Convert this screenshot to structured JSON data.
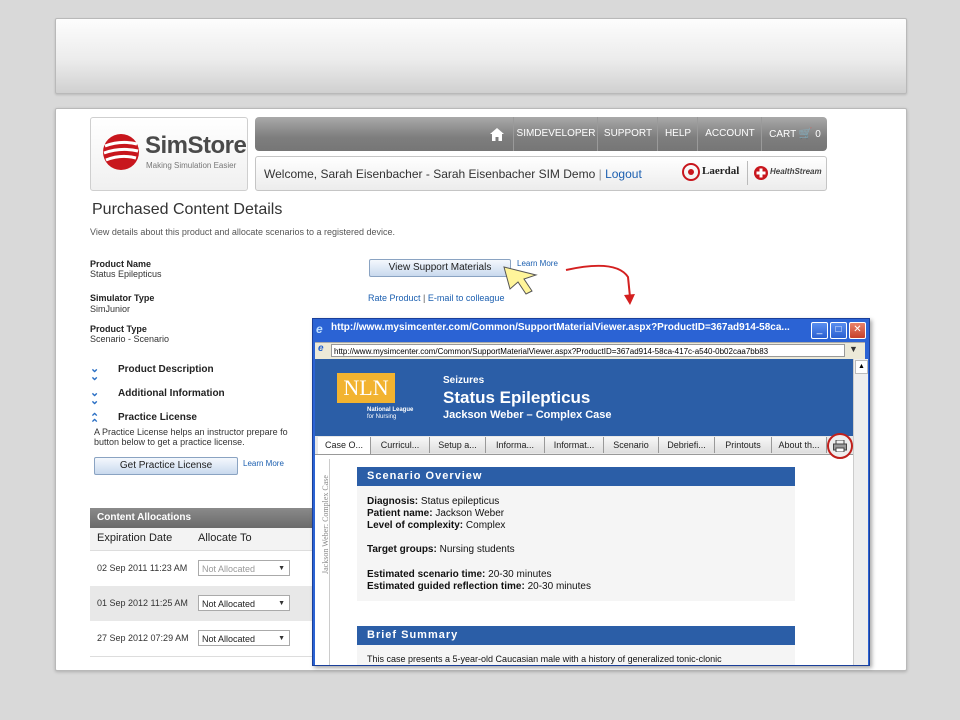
{
  "header": {
    "logo_name": "SimStore",
    "logo_tagline": "Making Simulation Easier",
    "nav": [
      "SIMDEVELOPER",
      "SUPPORT",
      "HELP",
      "ACCOUNT",
      "CART"
    ],
    "cart_count": "0",
    "welcome": "Welcome, Sarah Eisenbacher - Sarah Eisenbacher SIM Demo",
    "separator": "|",
    "logout": "Logout",
    "partner_logos": [
      "Laerdal",
      "HealthStream"
    ]
  },
  "page": {
    "title": "Purchased Content Details",
    "description": "View details about this product and allocate scenarios to a registered device.",
    "fields": [
      {
        "label": "Product Name",
        "value": "Status Epilepticus"
      },
      {
        "label": "Simulator Type",
        "value": "SimJunior"
      },
      {
        "label": "Product Type",
        "value": "Scenario - Scenario"
      }
    ],
    "sections": [
      "Product Description",
      "Additional Information",
      "Practice License"
    ],
    "practice_text": "A Practice License helps an instructor prepare fo",
    "practice_text_2": "button below to get a practice license.",
    "get_license_button": "Get Practice License",
    "learn_more": "Learn More",
    "view_support_button": "View Support Materials",
    "rate_product": "Rate Product",
    "email_colleague": "E-mail to colleague"
  },
  "allocations": {
    "title": "Content Allocations",
    "columns": [
      "Expiration Date",
      "Allocate To"
    ],
    "rows": [
      {
        "date": "02 Sep 2011 11:23 AM",
        "select": "Not Allocated"
      },
      {
        "date": "01 Sep 2012 11:25 AM",
        "select": "Not Allocated"
      },
      {
        "date": "27 Sep 2012 07:29 AM",
        "select": "Not Allocated"
      }
    ]
  },
  "popup": {
    "title": "http://www.mysimcenter.com/Common/SupportMaterialViewer.aspx?ProductID=367ad914-58ca...",
    "address": "http://www.mysimcenter.com/Common/SupportMaterialViewer.aspx?ProductID=367ad914-58ca-417c-a540-0b02caa7bb83",
    "nln_logo": "NLN",
    "nln_sub_1": "National League",
    "nln_sub_2": "for Nursing",
    "topic": "Seizures",
    "case_title": "Status Epilepticus",
    "case_subtitle": "Jackson Weber – Complex Case",
    "tabs": [
      "Case O...",
      "Curricul...",
      "Setup a...",
      "Informa...",
      "Informat...",
      "Scenario",
      "Debriefi...",
      "Printouts",
      "About th..."
    ],
    "side_label": "Jackson Weber: Complex Case",
    "overview_title": "Scenario Overview",
    "diagnosis_label": "Diagnosis:",
    "diagnosis": "Status epilepticus",
    "patient_label": "Patient name:",
    "patient": "Jackson Weber",
    "complexity_label": "Level of complexity:",
    "complexity": "Complex",
    "target_label": "Target groups:",
    "target": "Nursing students",
    "time_label": "Estimated scenario time:",
    "time": "20-30 minutes",
    "reflection_label": "Estimated guided reflection time:",
    "reflection": "20-30 minutes",
    "summary_title": "Brief Summary",
    "summary_text": "This case presents a 5-year-old Caucasian male with a history of generalized tonic-clonic"
  },
  "colors": {
    "accent_blue": "#2b5ea7",
    "nln_gold": "#f2b330",
    "arrow_red": "#d42020"
  }
}
